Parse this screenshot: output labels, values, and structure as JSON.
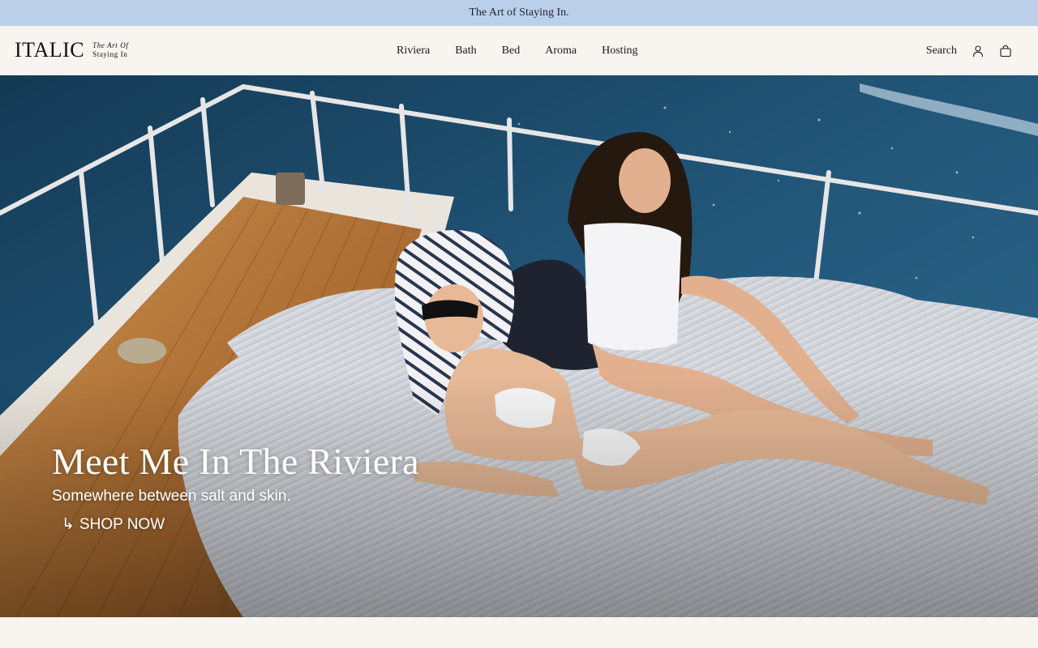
{
  "announcement": {
    "text": "The Art of Staying In."
  },
  "brand": {
    "name": "ITALIC",
    "tagline_line1": "The Art Of",
    "tagline_line2": "Staying In"
  },
  "nav": {
    "items": [
      {
        "label": "Riviera"
      },
      {
        "label": "Bath"
      },
      {
        "label": "Bed"
      },
      {
        "label": "Aroma"
      },
      {
        "label": "Hosting"
      }
    ]
  },
  "header_actions": {
    "search_label": "Search",
    "account_icon": "user-icon",
    "cart_icon": "shopping-bag-icon"
  },
  "hero": {
    "title": "Meet Me In The Riviera",
    "subtitle": "Somewhere between salt and skin.",
    "cta_arrow": "↳",
    "cta_label": "SHOP NOW"
  },
  "colors": {
    "announcement_bg": "#bccfe8",
    "page_bg": "#f8f4ef",
    "text_dark": "#1a1a1a",
    "hero_text": "#ffffff"
  }
}
